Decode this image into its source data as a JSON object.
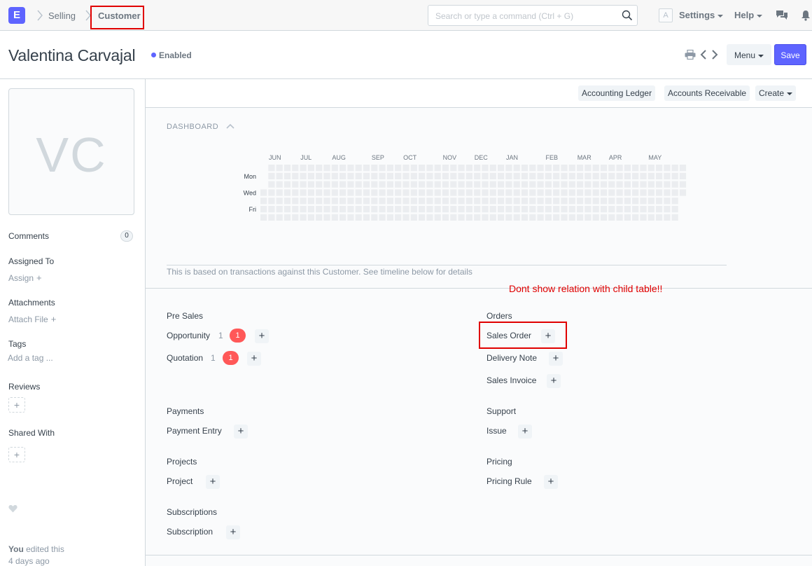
{
  "navbar": {
    "logo_letter": "E",
    "breadcrumbs": [
      "Selling",
      "Customer"
    ],
    "search_placeholder": "Search or type a command (Ctrl + G)",
    "avatar_letter": "A",
    "settings_label": "Settings",
    "help_label": "Help"
  },
  "header": {
    "title": "Valentina Carvajal",
    "status": "Enabled",
    "menu_label": "Menu",
    "save_label": "Save"
  },
  "sidebar": {
    "initials": "VC",
    "comments_label": "Comments",
    "comments_count": "0",
    "assigned_label": "Assigned To",
    "assign_action": "Assign",
    "attachments_label": "Attachments",
    "attach_action": "Attach File",
    "tags_label": "Tags",
    "tags_placeholder": "Add a tag ...",
    "reviews_label": "Reviews",
    "shared_label": "Shared With",
    "activity_user": "You",
    "activity_text": "edited this",
    "activity_time": "4 days ago"
  },
  "toolbar": {
    "buttons": [
      "Accounting Ledger",
      "Accounts Receivable",
      "Create"
    ]
  },
  "dashboard": {
    "label": "DASHBOARD",
    "months": [
      "JUN",
      "JUL",
      "AUG",
      "SEP",
      "OCT",
      "NOV",
      "DEC",
      "JAN",
      "FEB",
      "MAR",
      "APR",
      "MAY"
    ],
    "days": [
      "Mon",
      "Wed",
      "Fri"
    ],
    "note": "This is based on transactions against this Customer. See timeline below for details",
    "colors": {
      "empty": "#ebedf0",
      "background": "#fafbfc"
    }
  },
  "annotation": "Dont show relation with child table!!",
  "groups": {
    "pre_sales": {
      "title": "Pre Sales",
      "items": [
        {
          "label": "Opportunity",
          "count": "1",
          "open": "1"
        },
        {
          "label": "Quotation",
          "count": "1",
          "open": "1"
        }
      ]
    },
    "orders": {
      "title": "Orders",
      "items": [
        {
          "label": "Sales Order"
        },
        {
          "label": "Delivery Note"
        },
        {
          "label": "Sales Invoice"
        }
      ]
    },
    "payments": {
      "title": "Payments",
      "items": [
        {
          "label": "Payment Entry"
        }
      ]
    },
    "support": {
      "title": "Support",
      "items": [
        {
          "label": "Issue"
        }
      ]
    },
    "projects": {
      "title": "Projects",
      "items": [
        {
          "label": "Project"
        }
      ]
    },
    "pricing": {
      "title": "Pricing",
      "items": [
        {
          "label": "Pricing Rule"
        }
      ]
    },
    "subscriptions": {
      "title": "Subscriptions",
      "items": [
        {
          "label": "Subscription"
        }
      ]
    }
  },
  "colors": {
    "accent": "#5e64ff",
    "danger": "#ff5858",
    "annotation": "#e00000"
  }
}
